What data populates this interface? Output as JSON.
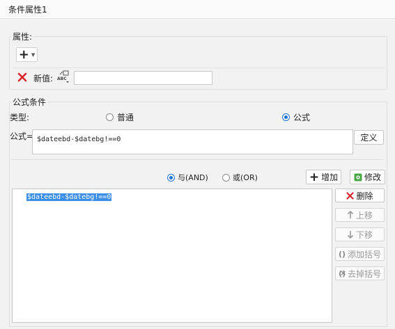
{
  "window": {
    "title": "条件属性1"
  },
  "properties": {
    "legend": "属性:",
    "add_glyph": "+",
    "new_value_label": "新值:",
    "abc_icon_text": "ABC",
    "new_value_input": ""
  },
  "formula_condition": {
    "legend": "公式条件",
    "type_label": "类型:",
    "type_options": [
      "普通",
      "公式"
    ],
    "type_selected": "公式",
    "formula_label": "公式=",
    "formula_value": "$dateebd-$datebg!==0",
    "define_button": "定义",
    "logic_and": "与(AND)",
    "logic_or": "或(OR)",
    "logic_selected": "与(AND)",
    "add_button": "增加",
    "modify_button": "修改",
    "conditions": [
      "$dateebd-$datebg!==0"
    ],
    "delete_button": "删除",
    "move_up_button": "上移",
    "move_down_button": "下移",
    "add_paren_button": "添加括号",
    "remove_paren_button": "去掉括号"
  },
  "colors": {
    "accent": "#1e6fd9",
    "delete_red": "#d9252b",
    "selection": "#3a8ee6"
  }
}
